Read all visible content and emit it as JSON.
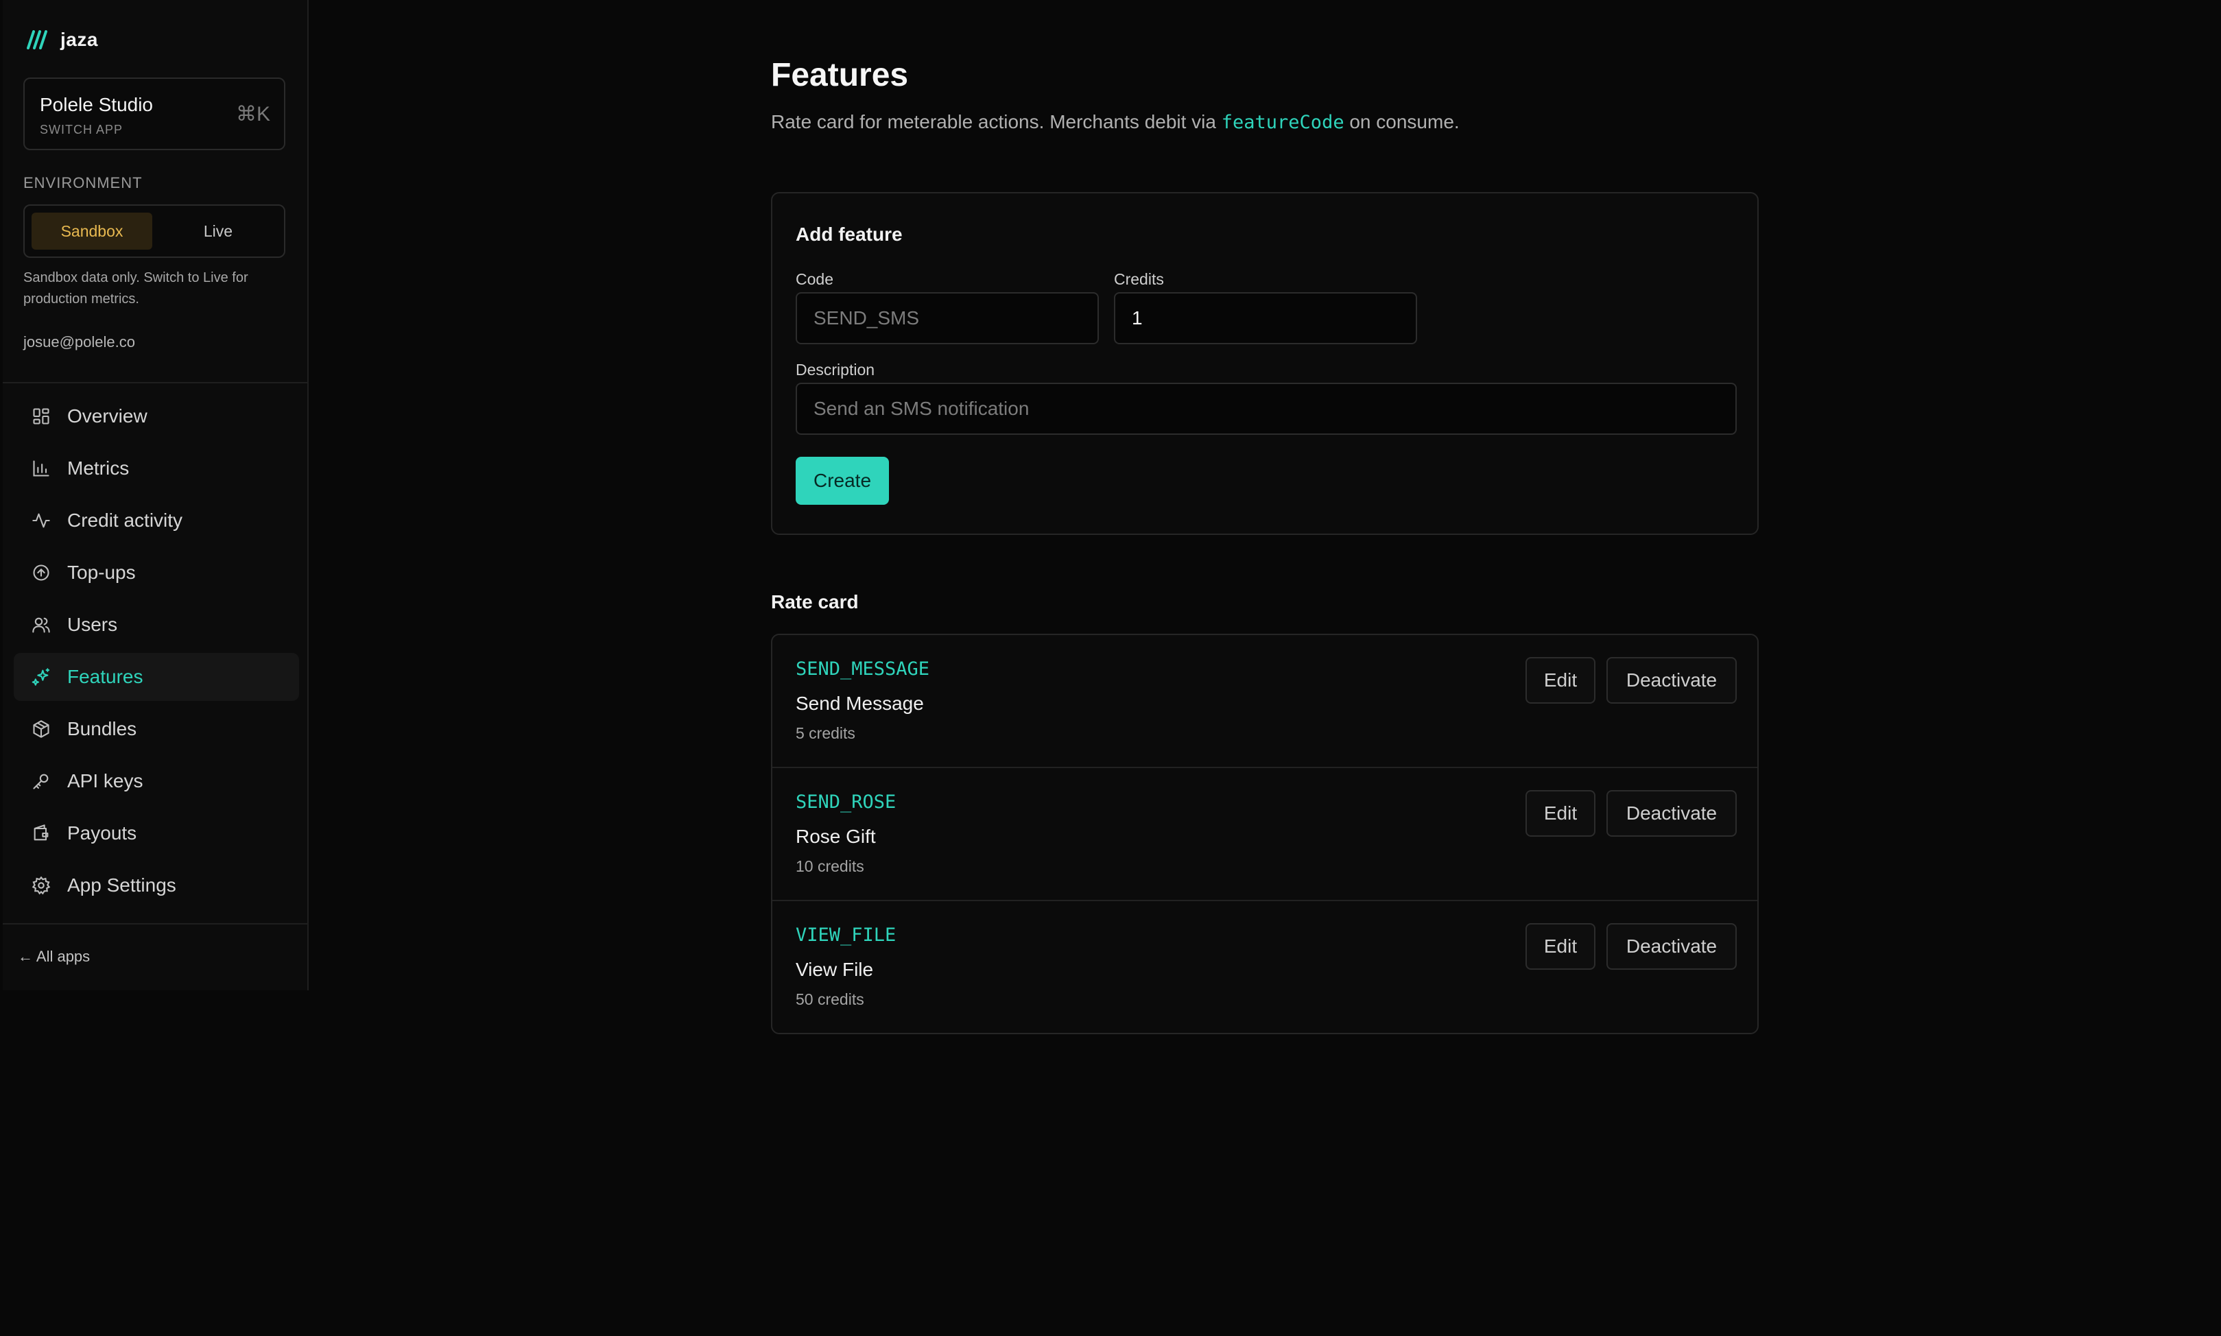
{
  "brand": {
    "name": "jaza",
    "accent": "#2fd4bb"
  },
  "app_switcher": {
    "name": "Polele Studio",
    "sub": "SWITCH APP",
    "shortcut": "⌘K"
  },
  "environment": {
    "label": "ENVIRONMENT",
    "options": [
      "Sandbox",
      "Live"
    ],
    "selected": "Sandbox",
    "note": "Sandbox data only. Switch to Live for production metrics.",
    "sandbox_color": "#e8b950"
  },
  "user": {
    "email": "josue@polele.co"
  },
  "nav": [
    {
      "label": "Overview",
      "icon": "dashboard-icon"
    },
    {
      "label": "Metrics",
      "icon": "bar-chart-icon"
    },
    {
      "label": "Credit activity",
      "icon": "activity-icon"
    },
    {
      "label": "Top-ups",
      "icon": "arrow-up-circle-icon"
    },
    {
      "label": "Users",
      "icon": "users-icon"
    },
    {
      "label": "Features",
      "icon": "sparkles-icon",
      "active": true
    },
    {
      "label": "Bundles",
      "icon": "package-icon"
    },
    {
      "label": "API keys",
      "icon": "key-icon"
    },
    {
      "label": "Payouts",
      "icon": "wallet-icon"
    },
    {
      "label": "App Settings",
      "icon": "gear-icon"
    }
  ],
  "footer": {
    "all_apps": "← All apps"
  },
  "page": {
    "title": "Features",
    "subtitle_before": "Rate card for meterable actions. Merchants debit via ",
    "subtitle_code": "featureCode",
    "subtitle_after": " on consume."
  },
  "add_feature": {
    "title": "Add feature",
    "code_label": "Code",
    "code_placeholder": "SEND_SMS",
    "credits_label": "Credits",
    "credits_value": "1",
    "description_label": "Description",
    "description_placeholder": "Send an SMS notification",
    "create_label": "Create"
  },
  "rate_card": {
    "title": "Rate card",
    "edit_label": "Edit",
    "deactivate_label": "Deactivate",
    "items": [
      {
        "code": "SEND_MESSAGE",
        "name": "Send Message",
        "credits": "5 credits"
      },
      {
        "code": "SEND_ROSE",
        "name": "Rose Gift",
        "credits": "10 credits"
      },
      {
        "code": "VIEW_FILE",
        "name": "View File",
        "credits": "50 credits"
      }
    ]
  }
}
